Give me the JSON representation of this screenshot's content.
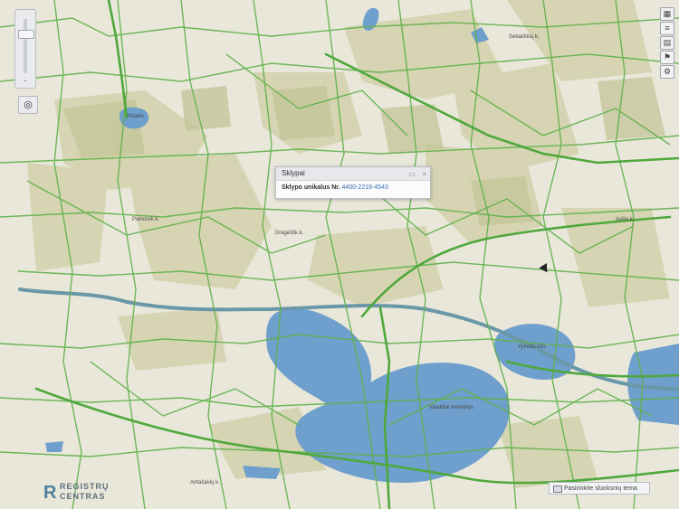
{
  "popup": {
    "title": "Sklypai",
    "field_label": "Sklypo unikalus Nr.",
    "field_value": "4400-2216-4543"
  },
  "map_labels": {
    "lake_top": "Alitaitis",
    "village_left": "Palnorek.k.",
    "village_center": "Dragelišk.k.",
    "village_top_right": "Sebališkių k.",
    "village_right": "Avilio k.",
    "lake_right": "Vykeže ežs.",
    "lake_center": "Vaiakhai tvenkinys",
    "village_bottom": "Antašavių k."
  },
  "logo": {
    "line1": "REGISTRŲ",
    "line2": "CENTRAS"
  },
  "layers_toggle_label": "Pasirinkite sluoksnių tema",
  "controls": {
    "zoom_minus": "-",
    "locate": "◎"
  },
  "colors": {
    "land": "#e9e7da",
    "field": "#d4d3ae",
    "forest": "#c9ca9f",
    "road": "#5fb14a",
    "water": "#6f9fcc",
    "river": "#6a98a8"
  }
}
